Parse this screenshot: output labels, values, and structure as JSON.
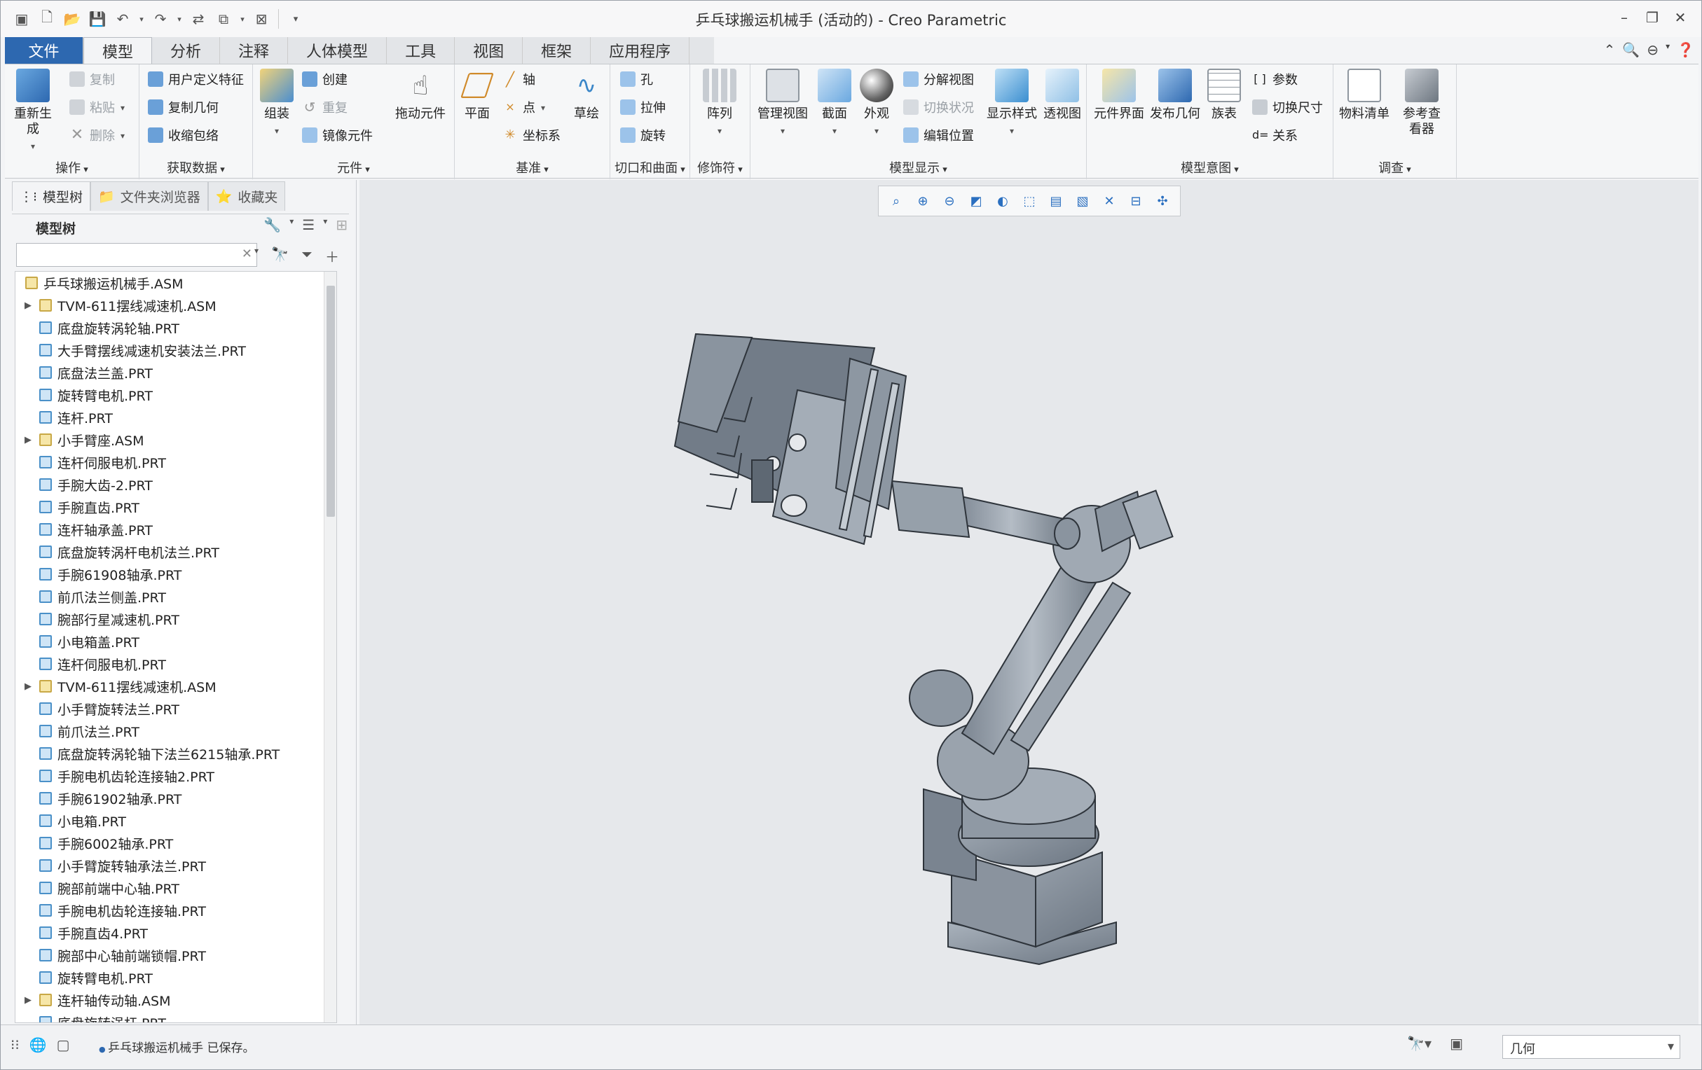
{
  "window": {
    "title": "乒乓球搬运机械手 (活动的) - Creo Parametric"
  },
  "tabs": [
    "文件",
    "模型",
    "分析",
    "注释",
    "人体模型",
    "工具",
    "视图",
    "框架",
    "应用程序"
  ],
  "ribbon": {
    "ops": {
      "label": "操作",
      "regen": "重新生成",
      "copy": "复制",
      "paste": "粘贴",
      "delete": "删除"
    },
    "getdata": {
      "label": "获取数据",
      "udf": "用户定义特征",
      "copygeom": "复制几何",
      "shrinkwrap": "收缩包络"
    },
    "comp": {
      "label": "元件",
      "assemble": "组装",
      "create": "创建",
      "repeat": "重复",
      "mirror": "镜像元件",
      "drag": "拖动元件"
    },
    "datum": {
      "label": "基准",
      "plane": "平面",
      "axis": "轴",
      "point": "点",
      "csys": "坐标系",
      "sketch": "草绘"
    },
    "cut": {
      "label": "切口和曲面",
      "hole": "孔",
      "extrude": "拉伸",
      "revolve": "旋转"
    },
    "modifiers": {
      "label": "修饰符",
      "pattern": "阵列"
    },
    "display": {
      "label": "模型显示",
      "manage": "管理视图",
      "section": "截面",
      "appearance": "外观",
      "explode": "分解视图",
      "toggle": "切换状况",
      "editpos": "编辑位置",
      "style": "显示样式",
      "persp": "透视图"
    },
    "intent": {
      "label": "模型意图",
      "cintf": "元件界面",
      "publish": "发布几何",
      "family": "族表",
      "params": "参数",
      "switchdim": "切换尺寸",
      "relations": "关系"
    },
    "investigate": {
      "label": "调查",
      "bom": "物料清单",
      "refviewer": "参考查看器"
    }
  },
  "panel": {
    "tabs": [
      "模型树",
      "文件夹浏览器",
      "收藏夹"
    ],
    "header": "模型树"
  },
  "tree": [
    {
      "label": "乒乓球搬运机械手.ASM",
      "type": "root"
    },
    {
      "label": "TVM-611摆线减速机.ASM",
      "type": "asm"
    },
    {
      "label": "底盘旋转涡轮轴.PRT",
      "type": "prt"
    },
    {
      "label": "大手臂摆线减速机安装法兰.PRT",
      "type": "prt"
    },
    {
      "label": "底盘法兰盖.PRT",
      "type": "prt"
    },
    {
      "label": "旋转臂电机.PRT",
      "type": "prt"
    },
    {
      "label": "连杆.PRT",
      "type": "prt"
    },
    {
      "label": "小手臂座.ASM",
      "type": "asm"
    },
    {
      "label": "连杆伺服电机.PRT",
      "type": "prt"
    },
    {
      "label": "手腕大齿-2.PRT",
      "type": "prt"
    },
    {
      "label": "手腕直齿.PRT",
      "type": "prt"
    },
    {
      "label": "连杆轴承盖.PRT",
      "type": "prt"
    },
    {
      "label": "底盘旋转涡杆电机法兰.PRT",
      "type": "prt"
    },
    {
      "label": "手腕61908轴承.PRT",
      "type": "prt"
    },
    {
      "label": "前爪法兰侧盖.PRT",
      "type": "prt"
    },
    {
      "label": "腕部行星减速机.PRT",
      "type": "prt"
    },
    {
      "label": "小电箱盖.PRT",
      "type": "prt"
    },
    {
      "label": "连杆伺服电机.PRT",
      "type": "prt"
    },
    {
      "label": "TVM-611摆线减速机.ASM",
      "type": "asm"
    },
    {
      "label": "小手臂旋转法兰.PRT",
      "type": "prt"
    },
    {
      "label": "前爪法兰.PRT",
      "type": "prt"
    },
    {
      "label": "底盘旋转涡轮轴下法兰6215轴承.PRT",
      "type": "prt"
    },
    {
      "label": "手腕电机齿轮连接轴2.PRT",
      "type": "prt"
    },
    {
      "label": "手腕61902轴承.PRT",
      "type": "prt"
    },
    {
      "label": "小电箱.PRT",
      "type": "prt"
    },
    {
      "label": "手腕6002轴承.PRT",
      "type": "prt"
    },
    {
      "label": "小手臂旋转轴承法兰.PRT",
      "type": "prt"
    },
    {
      "label": "腕部前端中心轴.PRT",
      "type": "prt"
    },
    {
      "label": "手腕电机齿轮连接轴.PRT",
      "type": "prt"
    },
    {
      "label": "手腕直齿4.PRT",
      "type": "prt"
    },
    {
      "label": "腕部中心轴前端锁帽.PRT",
      "type": "prt"
    },
    {
      "label": "旋转臂电机.PRT",
      "type": "prt"
    },
    {
      "label": "连杆轴传动轴.ASM",
      "type": "asm"
    },
    {
      "label": "底盘旋转涡杆.PRT",
      "type": "prt"
    }
  ],
  "status": {
    "message": "乒乓球搬运机械手 已保存。",
    "filter": "几何"
  },
  "colors": {
    "accent": "#2d68b0",
    "model": "#8d97a3",
    "background": "#e6e8eb"
  }
}
